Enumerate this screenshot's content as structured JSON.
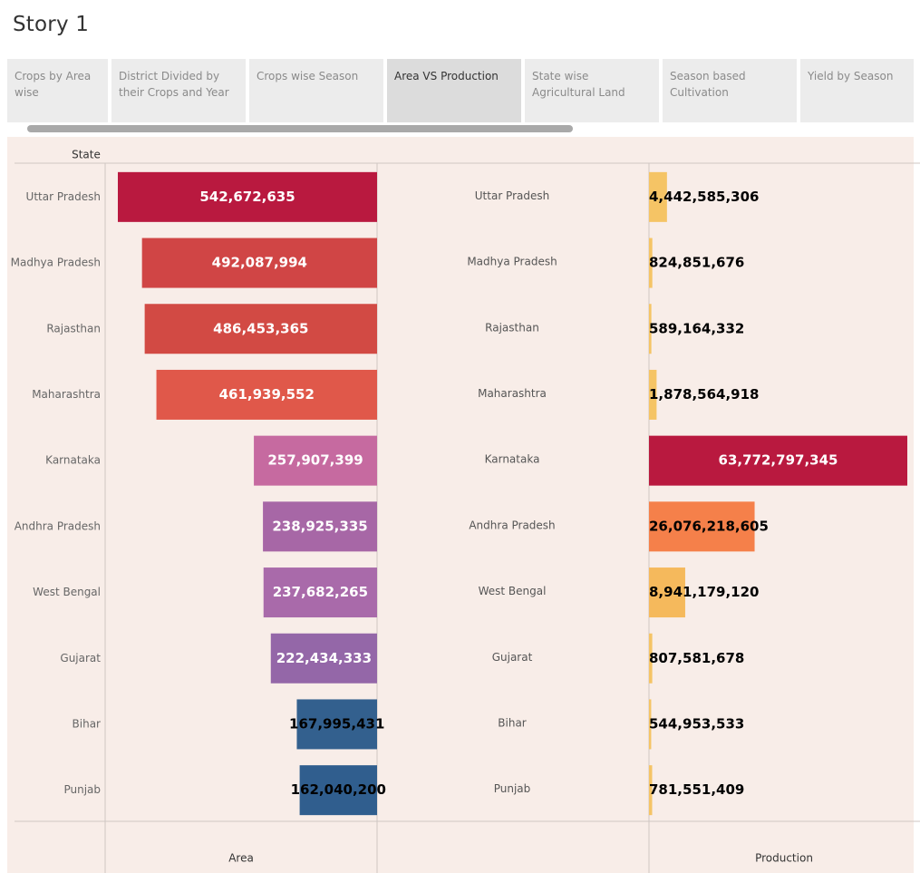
{
  "story_title": "Story 1",
  "tabs": [
    {
      "label": "Crops by  Area wise",
      "active": false
    },
    {
      "label": "District Divided by their Crops and Year",
      "active": false
    },
    {
      "label": "Crops wise Season",
      "active": false
    },
    {
      "label": "Area VS Production",
      "active": true
    },
    {
      "label": "State wise Agricultural Land",
      "active": false
    },
    {
      "label": "Season based Cultivation",
      "active": false
    },
    {
      "label": "Yield by Season",
      "active": false
    }
  ],
  "chart_data": {
    "type": "bar",
    "row_header": "State",
    "categories": [
      "Uttar Pradesh",
      "Madhya Pradesh",
      "Rajasthan",
      "Maharashtra",
      "Karnataka",
      "Andhra Pradesh",
      "West Bengal",
      "Gujarat",
      "Bihar",
      "Punjab"
    ],
    "series": [
      {
        "name": "Area",
        "values": [
          542672635,
          492087994,
          486453365,
          461939552,
          257907399,
          238925335,
          237682265,
          222434333,
          167995431,
          162040200
        ],
        "labels": [
          "542,672,635",
          "492,087,994",
          "486,453,365",
          "461,939,552",
          "257,907,399",
          "238,925,335",
          "237,682,265",
          "222,434,333",
          "167,995,431",
          "162,040,200"
        ],
        "colors": [
          "#b9193f",
          "#d04545",
          "#d24a44",
          "#e0584a",
          "#c66aa0",
          "#a767a6",
          "#a96aaa",
          "#9467a8",
          "#33608e",
          "#305e8e"
        ],
        "label_colors": [
          "#ffffff",
          "#ffffff",
          "#ffffff",
          "#ffffff",
          "#ffffff",
          "#ffffff",
          "#ffffff",
          "#ffffff",
          "#000000",
          "#000000"
        ],
        "direction": "reversed"
      },
      {
        "name": "Production",
        "values": [
          4442585306,
          824851676,
          589164332,
          1878564918,
          63772797345,
          26076218605,
          8941179120,
          807581678,
          544953533,
          781551409
        ],
        "labels": [
          "4,442,585,306",
          "824,851,676",
          "589,164,332",
          "1,878,564,918",
          "63,772,797,345",
          "26,076,218,605",
          "8,941,179,120",
          "807,581,678",
          "544,953,533",
          "781,551,409"
        ],
        "colors": [
          "#f5c465",
          "#f5c465",
          "#f5c465",
          "#f5c465",
          "#b9193f",
          "#f5804a",
          "#f5b95c",
          "#f5c465",
          "#f5c465",
          "#f5c465"
        ],
        "label_colors": [
          "#000000",
          "#000000",
          "#000000",
          "#000000",
          "#ffffff",
          "#000000",
          "#000000",
          "#000000",
          "#000000",
          "#000000"
        ],
        "direction": "normal"
      }
    ]
  }
}
